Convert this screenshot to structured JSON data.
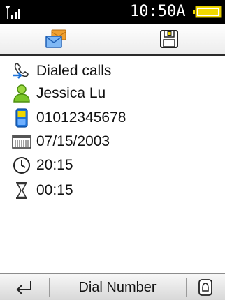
{
  "status_bar": {
    "time": "10:50A",
    "signal_icon": "signal-strength-icon",
    "battery_icon": "battery-icon"
  },
  "toolbar": {
    "left_icon": "messages-icon",
    "right_icon": "save-icon"
  },
  "details": [
    {
      "icon": "dialed-call-icon",
      "text": "Dialed calls"
    },
    {
      "icon": "contact-person-icon",
      "text": "Jessica Lu"
    },
    {
      "icon": "mobile-phone-icon",
      "text": "01012345678"
    },
    {
      "icon": "calendar-icon",
      "text": "07/15/2003"
    },
    {
      "icon": "clock-icon",
      "text": "20:15"
    },
    {
      "icon": "hourglass-icon",
      "text": "00:15"
    }
  ],
  "softkeys": {
    "left_icon": "back-icon",
    "center_label": "Dial Number",
    "right_icon": "home-icon"
  },
  "colors": {
    "status_bar_bg": "#000000",
    "battery_yellow": "#f0d800",
    "contact_green": "#7bc62a",
    "phone_blue": "#1e73d9",
    "envelope_blue": "#2a7be0",
    "folder_orange": "#f0a030"
  }
}
